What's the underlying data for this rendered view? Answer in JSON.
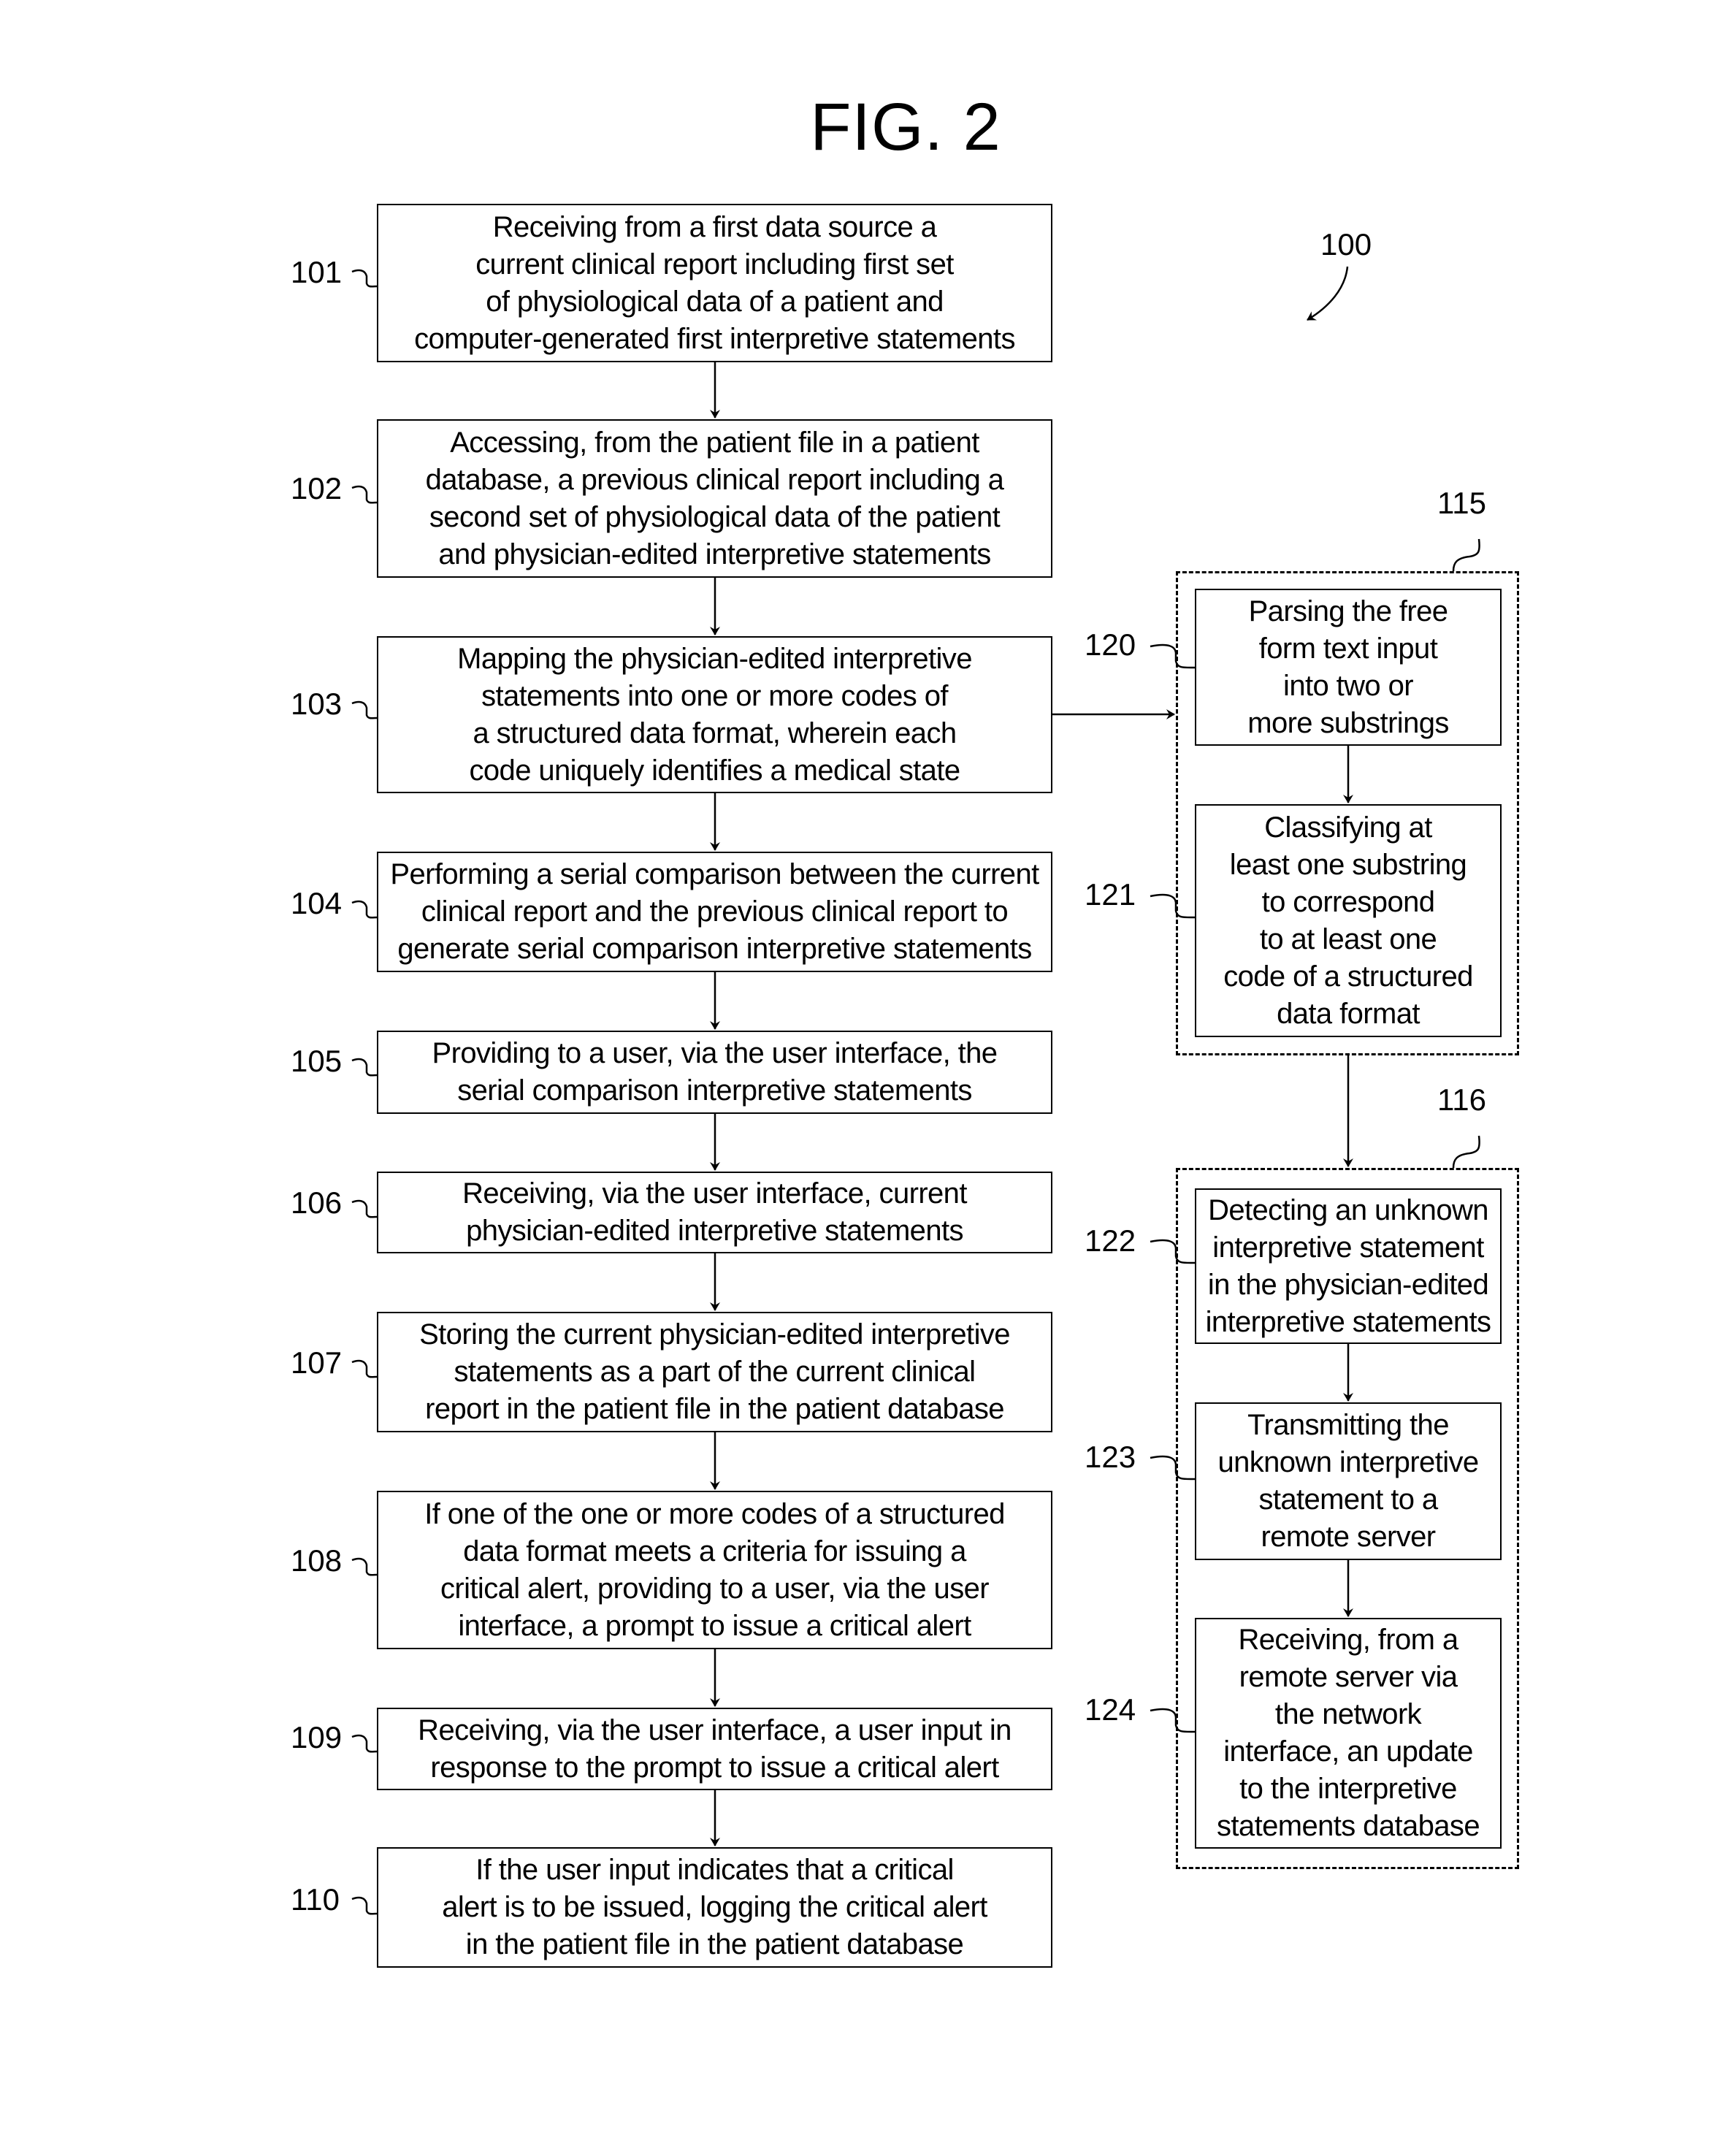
{
  "figure": {
    "title": "FIG. 2",
    "method_ref": "100"
  },
  "left_column": [
    {
      "ref": "101",
      "text": "Receiving from a first data source a\ncurrent clinical report including first set\nof physiological data of a patient and\ncomputer-generated first interpretive statements"
    },
    {
      "ref": "102",
      "text": "Accessing, from the patient file in a patient\ndatabase, a previous clinical report including a\nsecond set of physiological data of the patient\nand physician-edited interpretive statements"
    },
    {
      "ref": "103",
      "text": "Mapping the physician-edited interpretive\nstatements into one or more codes of\na structured data format, wherein each\ncode uniquely identifies a medical state"
    },
    {
      "ref": "104",
      "text": "Performing a serial comparison between the current\nclinical report and the previous clinical report to\ngenerate serial comparison interpretive statements"
    },
    {
      "ref": "105",
      "text": "Providing to a user, via the user interface, the\nserial comparison interpretive statements"
    },
    {
      "ref": "106",
      "text": "Receiving, via the user interface, current\nphysician-edited interpretive statements"
    },
    {
      "ref": "107",
      "text": "Storing the current physician-edited interpretive\nstatements as a part of the current clinical\nreport in the patient file in the patient database"
    },
    {
      "ref": "108",
      "text": "If one of the one or more codes of a structured\ndata format meets a criteria for issuing a\ncritical alert, providing to a user, via the user\ninterface, a prompt to issue a critical alert"
    },
    {
      "ref": "109",
      "text": "Receiving, via the user interface, a user input in\nresponse to the prompt to issue a critical alert"
    },
    {
      "ref": "110",
      "text": "If the user input indicates that a critical\nalert is to be issued, logging the critical alert\nin the patient file in the patient database"
    }
  ],
  "group_115": {
    "ref": "115",
    "steps": [
      {
        "ref": "120",
        "text": "Parsing the free\nform text input\ninto two or\nmore substrings"
      },
      {
        "ref": "121",
        "text": "Classifying at\nleast one substring\nto correspond\nto at least one\ncode of a structured\ndata format"
      }
    ]
  },
  "group_116": {
    "ref": "116",
    "steps": [
      {
        "ref": "122",
        "text": "Detecting an unknown\ninterpretive statement\nin the physician-edited\ninterpretive statements"
      },
      {
        "ref": "123",
        "text": "Transmitting the\nunknown interpretive\nstatement to a\nremote server"
      },
      {
        "ref": "124",
        "text": "Receiving, from a\nremote server via\nthe network\ninterface, an update\nto the interpretive\nstatements database"
      }
    ]
  }
}
